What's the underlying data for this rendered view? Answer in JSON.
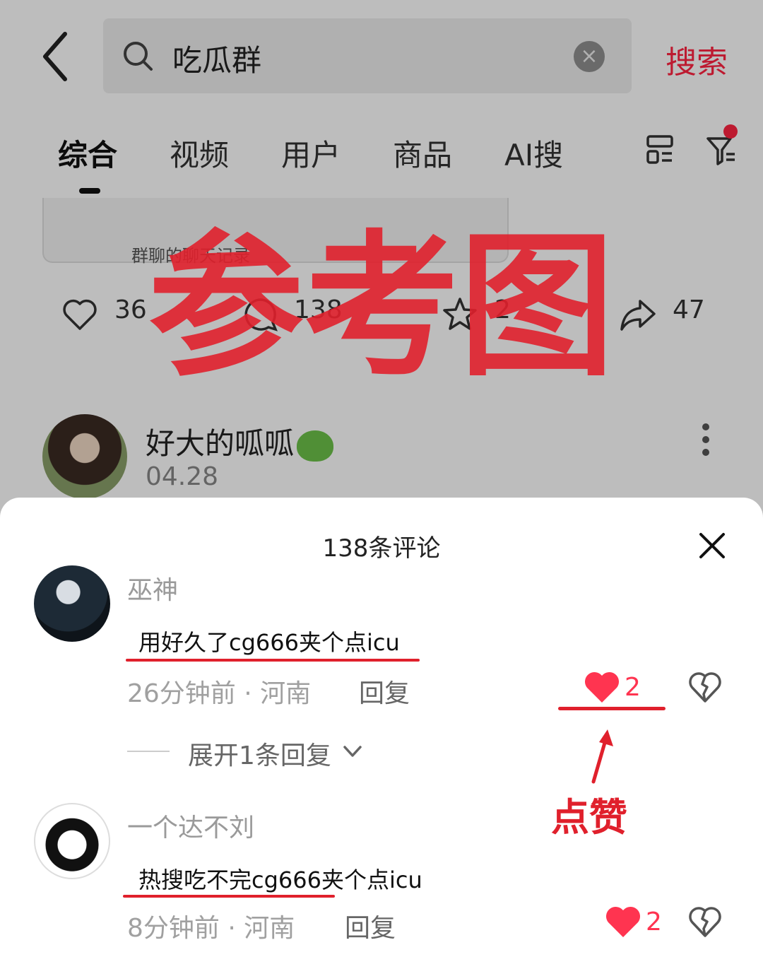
{
  "search": {
    "query": "吃瓜群",
    "button_label": "搜索"
  },
  "tabs": [
    {
      "label": "综合",
      "active": true
    },
    {
      "label": "视频",
      "active": false
    },
    {
      "label": "用户",
      "active": false
    },
    {
      "label": "商品",
      "active": false
    },
    {
      "label": "AI搜",
      "active": false
    }
  ],
  "feed_card": {
    "quote_text": "群聊的聊天记录",
    "likes": "36",
    "comments": "138",
    "collects": "2",
    "shares": "47"
  },
  "post": {
    "author": "好大的呱呱",
    "date": "04.28"
  },
  "watermark": "参考图",
  "comments_sheet": {
    "title": "138条评论",
    "comments": [
      {
        "user": "巫神",
        "text": "用好久了cg666夹个点icu",
        "time": "26分钟前",
        "location": "河南",
        "reply_label": "回复",
        "likes": "2",
        "expand_label": "展开1条回复"
      },
      {
        "user": "一个达不刘",
        "text": "热搜吃不完cg666夹个点icu",
        "time": "8分钟前",
        "location": "河南",
        "reply_label": "回复",
        "likes": "2"
      }
    ]
  },
  "annotation": {
    "label": "点赞"
  },
  "colors": {
    "accent": "#ff2442",
    "annotation_red": "#e0202c",
    "like_red": "#ff3450"
  },
  "icons": [
    "back-arrow-icon",
    "search-icon",
    "clear-icon",
    "layout-icon",
    "filter-icon",
    "heart-outline-icon",
    "comment-icon",
    "star-icon",
    "share-icon",
    "more-icon",
    "close-icon",
    "heart-filled-icon",
    "broken-heart-icon",
    "chevron-down-icon"
  ]
}
